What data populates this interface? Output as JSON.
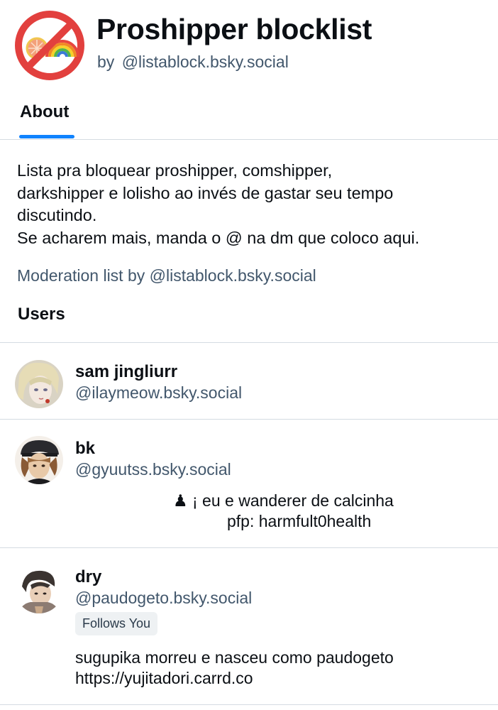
{
  "list": {
    "title": "Proshipper blocklist",
    "by_label": "by",
    "author_handle": "@listablock.bsky.social",
    "avatar_icon": "no-rainbow-icon"
  },
  "tabs": [
    {
      "label": "About",
      "active": true
    }
  ],
  "description": [
    "Lista pra bloquear proshipper, comshipper,",
    "darkshipper e lolisho ao invés de gastar seu tempo",
    "discutindo.",
    "Se acharem mais, manda o @ na dm que coloco aqui."
  ],
  "moderation_line": "Moderation list by @listablock.bsky.social",
  "users_heading": "Users",
  "users": [
    {
      "name": "sam jingliurr",
      "handle": "@ilaymeow.bsky.social",
      "bio": []
    },
    {
      "name": "bk",
      "handle": "@gyuutss.bsky.social",
      "bio": [
        "♟ ¡ eu e wanderer de calcinha",
        "pfp: harmfult0health"
      ]
    },
    {
      "name": "dry",
      "handle": "@paudogeto.bsky.social",
      "badge": "Follows You",
      "bio": [
        "sugupika morreu e nasceu como paudogeto",
        "https://yujitadori.carrd.co"
      ]
    }
  ],
  "colors": {
    "accent": "#1083fe",
    "secondary_text": "#42576c",
    "divider": "#d4dbe2",
    "no_sign_red": "#e2403e"
  }
}
